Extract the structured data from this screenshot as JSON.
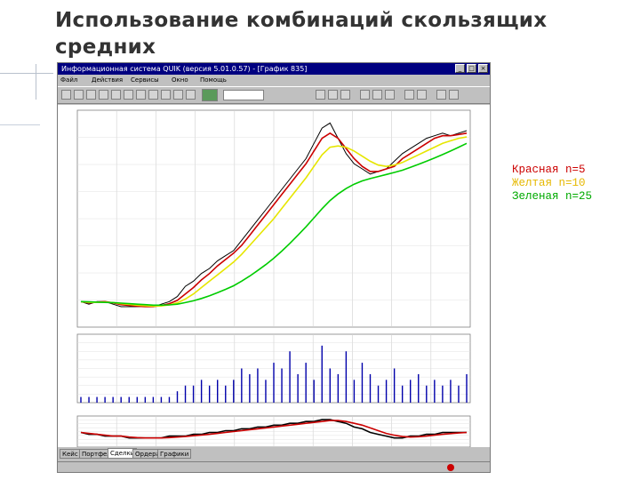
{
  "slide": {
    "title": "Использование комбинаций скользящих средних",
    "legend": [
      {
        "text": "Красная n=5",
        "color": "#cc0000"
      },
      {
        "text": "Желтая n=10",
        "color": "#e6b800"
      },
      {
        "text": "Зеленая n=25",
        "color": "#00aa00"
      }
    ]
  },
  "app": {
    "title": "Информационная система QUIK (версия 5.01.0.57) - [График 835]",
    "menu": [
      "Файл",
      "Действия",
      "Сервисы",
      "Окно",
      "Помощь"
    ],
    "tabs": [
      "Кейс",
      "Портфель",
      "Сделки",
      "Ордера",
      "Графики"
    ],
    "active_tab": 2,
    "title_bar_color": "#000080"
  },
  "chart_data": [
    {
      "type": "line",
      "title": "",
      "series": [
        {
          "name": "",
          "role": "price",
          "color": "#000000",
          "values": [
            60,
            59,
            60,
            60,
            59,
            58,
            58,
            58,
            58,
            58,
            59,
            60,
            62,
            66,
            68,
            71,
            73,
            76,
            78,
            80,
            84,
            88,
            92,
            96,
            100,
            104,
            108,
            112,
            116,
            122,
            128,
            130,
            124,
            118,
            114,
            112,
            110,
            111,
            112,
            115,
            118,
            120,
            122,
            124,
            125,
            126,
            125,
            126,
            127
          ]
        },
        {
          "name": "",
          "role": "ma5",
          "color": "#cc0000",
          "values": [
            60,
            59.5,
            59.8,
            60,
            59.5,
            58.8,
            58.5,
            58.2,
            58,
            58,
            58.5,
            59.2,
            60.5,
            63,
            65.5,
            68.5,
            71,
            74,
            76.5,
            79,
            82,
            86,
            90,
            94,
            98,
            102,
            106,
            110,
            114,
            119,
            124,
            126,
            124,
            120,
            116,
            113,
            111,
            111,
            112,
            113,
            116,
            118,
            120,
            122,
            124,
            125,
            125,
            125.5,
            126
          ]
        },
        {
          "name": "",
          "role": "ma10",
          "color": "#e6e600",
          "values": [
            60,
            59.7,
            59.7,
            59.8,
            59.6,
            59.2,
            58.9,
            58.6,
            58.4,
            58.2,
            58.3,
            58.7,
            59.5,
            61,
            63,
            65.5,
            68,
            70.5,
            73,
            75.5,
            78.5,
            82,
            85.5,
            89,
            92.5,
            96.5,
            100.5,
            104.5,
            108.5,
            113,
            117.5,
            120.5,
            121,
            120.5,
            119,
            117,
            115,
            113.5,
            113,
            113.5,
            114.5,
            116,
            117.5,
            119,
            120.5,
            122,
            123,
            124,
            124.5
          ]
        },
        {
          "name": "",
          "role": "ma25",
          "color": "#00cc00",
          "values": [
            60,
            59.9,
            59.8,
            59.7,
            59.6,
            59.4,
            59.2,
            59,
            58.8,
            58.6,
            58.6,
            58.7,
            59,
            59.6,
            60.3,
            61.2,
            62.3,
            63.5,
            64.8,
            66.2,
            68,
            70,
            72.2,
            74.5,
            77,
            79.8,
            82.8,
            86,
            89.3,
            92.8,
            96.4,
            99.6,
            102.2,
            104.3,
            106,
            107.3,
            108.2,
            109,
            109.8,
            110.6,
            111.5,
            112.6,
            113.8,
            115,
            116.3,
            117.6,
            119,
            120.5,
            122
          ]
        }
      ],
      "ylim": [
        50,
        135
      ],
      "grid": true
    },
    {
      "type": "bar",
      "title": "",
      "values": [
        1,
        1,
        1,
        1,
        1,
        1,
        1,
        1,
        1,
        1,
        1,
        1,
        2,
        3,
        3,
        4,
        3,
        4,
        3,
        4,
        6,
        5,
        6,
        4,
        7,
        6,
        9,
        5,
        7,
        4,
        10,
        6,
        5,
        9,
        4,
        7,
        5,
        3,
        4,
        6,
        3,
        4,
        5,
        3,
        4,
        3,
        4,
        3,
        5
      ],
      "ylim": [
        0,
        12
      ]
    },
    {
      "type": "line",
      "title": "",
      "series": [
        {
          "name": "",
          "role": "oscillator",
          "color": "#000000",
          "values": [
            0,
            -1,
            -1,
            -2,
            -2,
            -2,
            -3,
            -3,
            -3,
            -3,
            -3,
            -2,
            -2,
            -2,
            -1,
            -1,
            0,
            0,
            1,
            1,
            2,
            2,
            3,
            3,
            4,
            4,
            5,
            5,
            6,
            6,
            7,
            7,
            6,
            5,
            3,
            2,
            0,
            -1,
            -2,
            -3,
            -3,
            -2,
            -2,
            -1,
            -1,
            0,
            0,
            0,
            0
          ]
        },
        {
          "name": "",
          "role": "signal",
          "color": "#cc0000",
          "values": [
            0,
            -0.5,
            -1,
            -1.5,
            -2,
            -2,
            -2.5,
            -2.8,
            -3,
            -3,
            -3,
            -2.8,
            -2.5,
            -2.2,
            -1.8,
            -1.4,
            -1,
            -0.5,
            0,
            0.5,
            1,
            1.5,
            2,
            2.5,
            3,
            3.5,
            4,
            4.5,
            5,
            5.5,
            6,
            6.5,
            6.5,
            6,
            5,
            4,
            2.5,
            1,
            -0.5,
            -1.5,
            -2.2,
            -2.5,
            -2.3,
            -2,
            -1.5,
            -1,
            -0.6,
            -0.3,
            0
          ]
        }
      ],
      "ylim": [
        -8,
        9
      ],
      "grid": true
    }
  ]
}
